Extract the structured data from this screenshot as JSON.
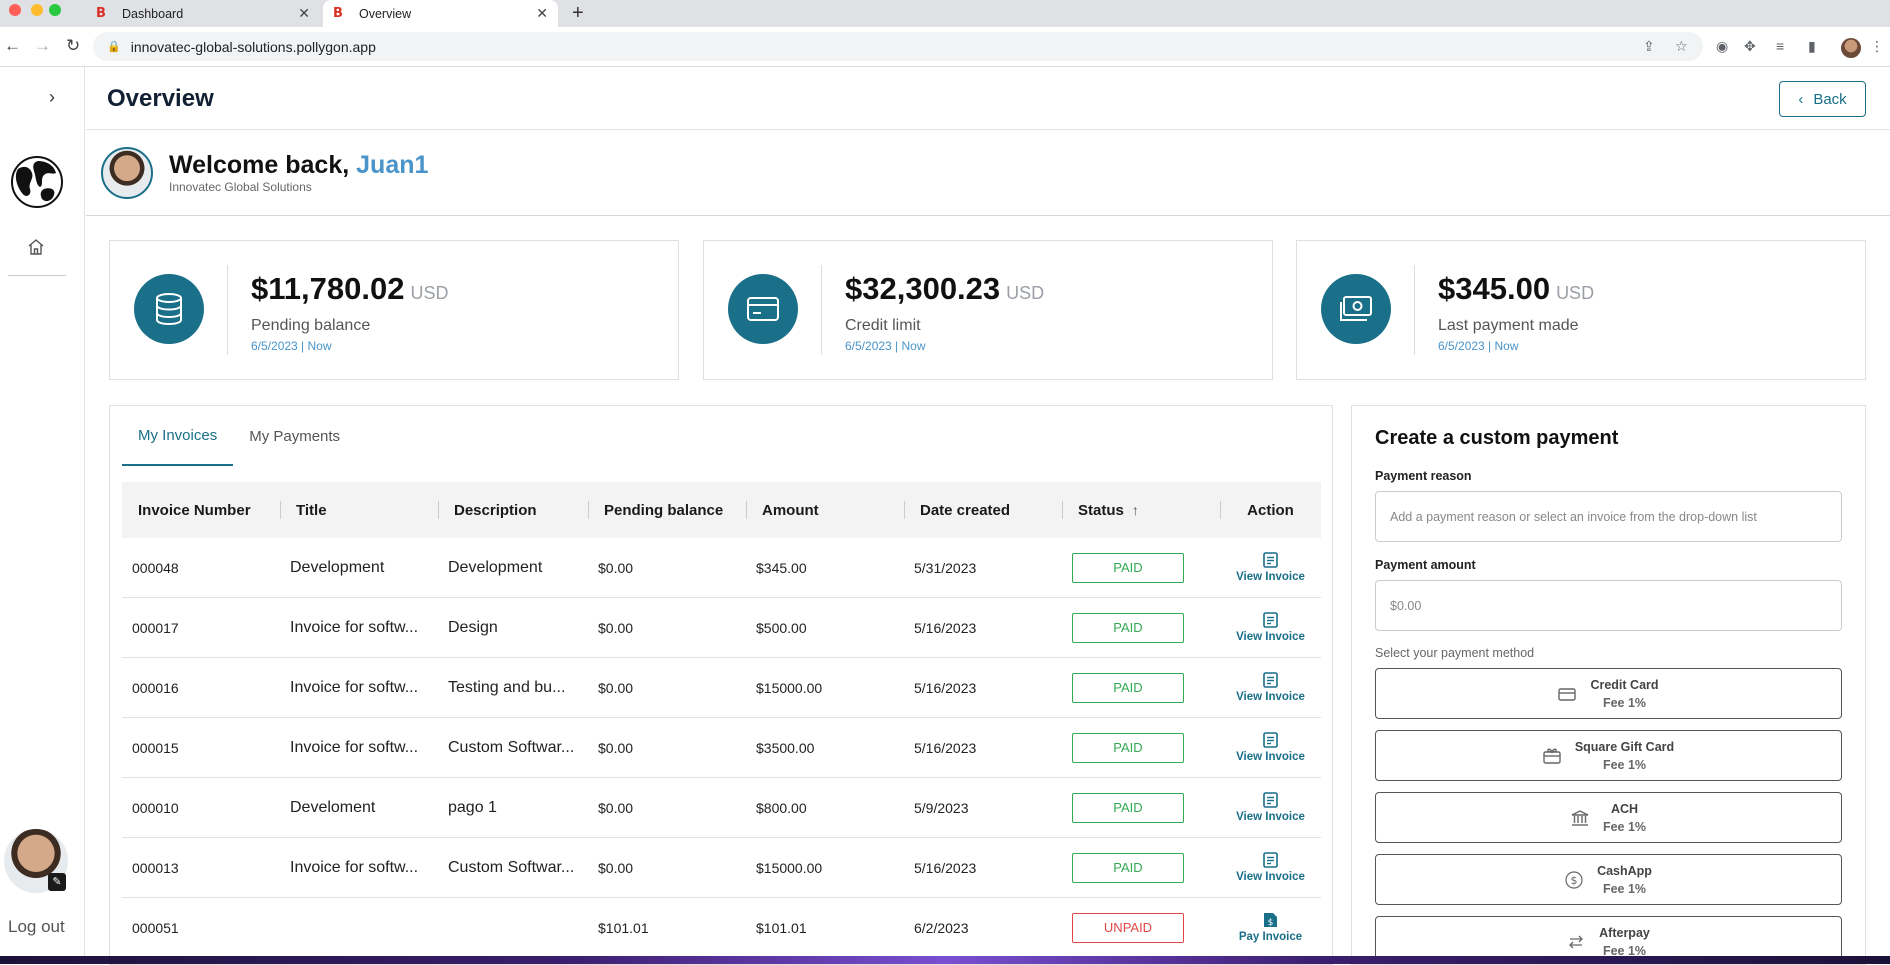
{
  "browser": {
    "tabs": [
      {
        "title": "Dashboard",
        "active": false
      },
      {
        "title": "Overview",
        "active": true
      }
    ],
    "url": "innovatec-global-solutions.pollygon.app"
  },
  "sidebar": {
    "logout_label": "Log out"
  },
  "header": {
    "title": "Overview",
    "back_label": "Back"
  },
  "welcome": {
    "greeting": "Welcome back,",
    "name": "Juan1",
    "company": "Innovatec Global Solutions"
  },
  "stats": [
    {
      "amount": "$11,780.02",
      "currency": "USD",
      "label": "Pending balance",
      "date": "6/5/2023 | Now"
    },
    {
      "amount": "$32,300.23",
      "currency": "USD",
      "label": "Credit limit",
      "date": "6/5/2023 | Now"
    },
    {
      "amount": "$345.00",
      "currency": "USD",
      "label": "Last payment made",
      "date": "6/5/2023 | Now"
    }
  ],
  "invoices": {
    "tabs": [
      "My Invoices",
      "My Payments"
    ],
    "columns": [
      "Invoice Number",
      "Title",
      "Description",
      "Pending balance",
      "Amount",
      "Date created",
      "Status",
      "Action"
    ],
    "rows": [
      {
        "number": "000048",
        "title": "Development",
        "description": "Development",
        "pending": "$0.00",
        "amount": "$345.00",
        "date": "5/31/2023",
        "status": "PAID",
        "action": "View Invoice"
      },
      {
        "number": "000017",
        "title": "Invoice for softw...",
        "description": "Design",
        "pending": "$0.00",
        "amount": "$500.00",
        "date": "5/16/2023",
        "status": "PAID",
        "action": "View Invoice"
      },
      {
        "number": "000016",
        "title": "Invoice for softw...",
        "description": "Testing and bu...",
        "pending": "$0.00",
        "amount": "$15000.00",
        "date": "5/16/2023",
        "status": "PAID",
        "action": "View Invoice"
      },
      {
        "number": "000015",
        "title": "Invoice for softw...",
        "description": "Custom Softwar...",
        "pending": "$0.00",
        "amount": "$3500.00",
        "date": "5/16/2023",
        "status": "PAID",
        "action": "View Invoice"
      },
      {
        "number": "000010",
        "title": "Develoment",
        "description": "pago 1",
        "pending": "$0.00",
        "amount": "$800.00",
        "date": "5/9/2023",
        "status": "PAID",
        "action": "View Invoice"
      },
      {
        "number": "000013",
        "title": "Invoice for softw...",
        "description": "Custom Softwar...",
        "pending": "$0.00",
        "amount": "$15000.00",
        "date": "5/16/2023",
        "status": "PAID",
        "action": "View Invoice"
      },
      {
        "number": "000051",
        "title": "",
        "description": "",
        "pending": "$101.01",
        "amount": "$101.01",
        "date": "6/2/2023",
        "status": "UNPAID",
        "action": "Pay Invoice"
      }
    ]
  },
  "payment": {
    "title": "Create a custom payment",
    "reason_label": "Payment reason",
    "reason_placeholder": "Add a payment reason or select an invoice from the drop-down list",
    "amount_label": "Payment amount",
    "amount_placeholder": "$0.00",
    "method_label": "Select your payment method",
    "methods": [
      {
        "name": "Credit Card",
        "fee": "Fee 1%",
        "icon": "credit-card-icon"
      },
      {
        "name": "Square Gift Card",
        "fee": "Fee 1%",
        "icon": "gift-card-icon"
      },
      {
        "name": "ACH",
        "fee": "Fee 1%",
        "icon": "bank-icon"
      },
      {
        "name": "CashApp",
        "fee": "Fee 1%",
        "icon": "dollar-circle-icon"
      },
      {
        "name": "Afterpay",
        "fee": "Fee 1%",
        "icon": "arrows-exchange-icon"
      }
    ]
  }
}
